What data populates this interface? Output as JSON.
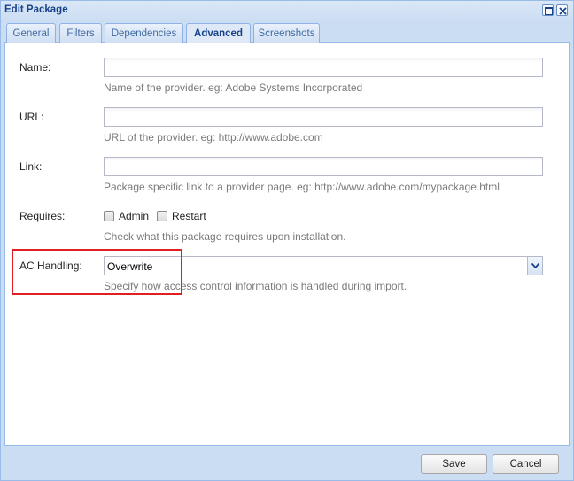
{
  "window": {
    "title": "Edit Package"
  },
  "tabs": [
    {
      "label": "General"
    },
    {
      "label": "Filters"
    },
    {
      "label": "Dependencies"
    },
    {
      "label": "Advanced",
      "active": true
    },
    {
      "label": "Screenshots"
    }
  ],
  "form": {
    "name": {
      "label": "Name:",
      "value": "",
      "hint": "Name of the provider. eg: Adobe Systems Incorporated"
    },
    "url": {
      "label": "URL:",
      "value": "",
      "hint": "URL of the provider. eg: http://www.adobe.com"
    },
    "link": {
      "label": "Link:",
      "value": "",
      "hint": "Package specific link to a provider page. eg: http://www.adobe.com/mypackage.html"
    },
    "requires": {
      "label": "Requires:",
      "options": [
        {
          "label": "Admin",
          "checked": false
        },
        {
          "label": "Restart",
          "checked": false
        }
      ],
      "hint": "Check what this package requires upon installation."
    },
    "ac_handling": {
      "label": "AC Handling:",
      "value": "Overwrite",
      "hint": "Specify how access control information is handled during import."
    }
  },
  "buttons": {
    "save": "Save",
    "cancel": "Cancel"
  },
  "colors": {
    "highlight": "#e02020",
    "title": "#15428b"
  },
  "icons": {
    "maximize": "maximize-icon",
    "close": "close-icon",
    "dropdown": "chevron-down-icon"
  }
}
